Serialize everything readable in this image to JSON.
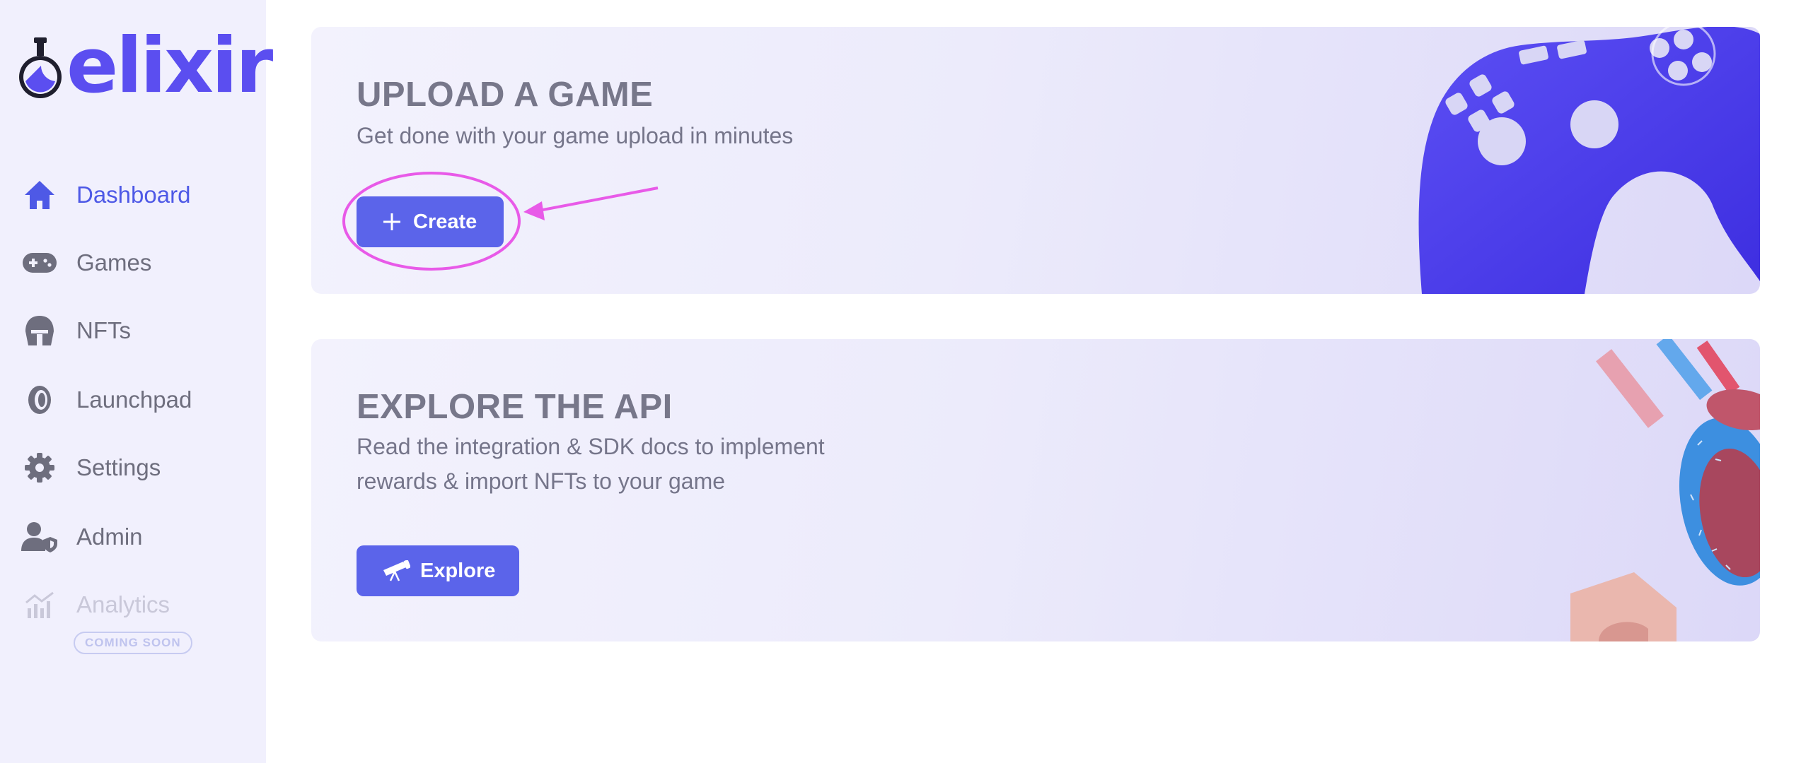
{
  "app": {
    "brand": "elixir"
  },
  "sidebar": {
    "items": [
      {
        "label": "Dashboard",
        "icon": "home-icon",
        "active": true
      },
      {
        "label": "Games",
        "icon": "gamepad-icon"
      },
      {
        "label": "NFTs",
        "icon": "helmet-icon"
      },
      {
        "label": "Launchpad",
        "icon": "coin-icon"
      },
      {
        "label": "Settings",
        "icon": "gear-icon"
      },
      {
        "label": "Admin",
        "icon": "user-shield-icon"
      },
      {
        "label": "Analytics",
        "icon": "chart-icon",
        "disabled": true
      }
    ],
    "analytics_badge": "COMING SOON"
  },
  "cards": {
    "upload": {
      "title": "UPLOAD A GAME",
      "subtitle": "Get done with your game upload in minutes",
      "button_label": "Create",
      "button_icon": "plus-icon"
    },
    "explore": {
      "title": "EXPLORE THE API",
      "subtitle_line1": "Read the integration & SDK docs to implement",
      "subtitle_line2": "rewards & import NFTs to your game",
      "button_label": "Explore",
      "button_icon": "telescope-icon"
    }
  },
  "colors": {
    "accent": "#5b64ea",
    "brand": "#5b4ef0",
    "sidebar_bg": "#f1f0fd",
    "annotation": "#e85ae8"
  }
}
